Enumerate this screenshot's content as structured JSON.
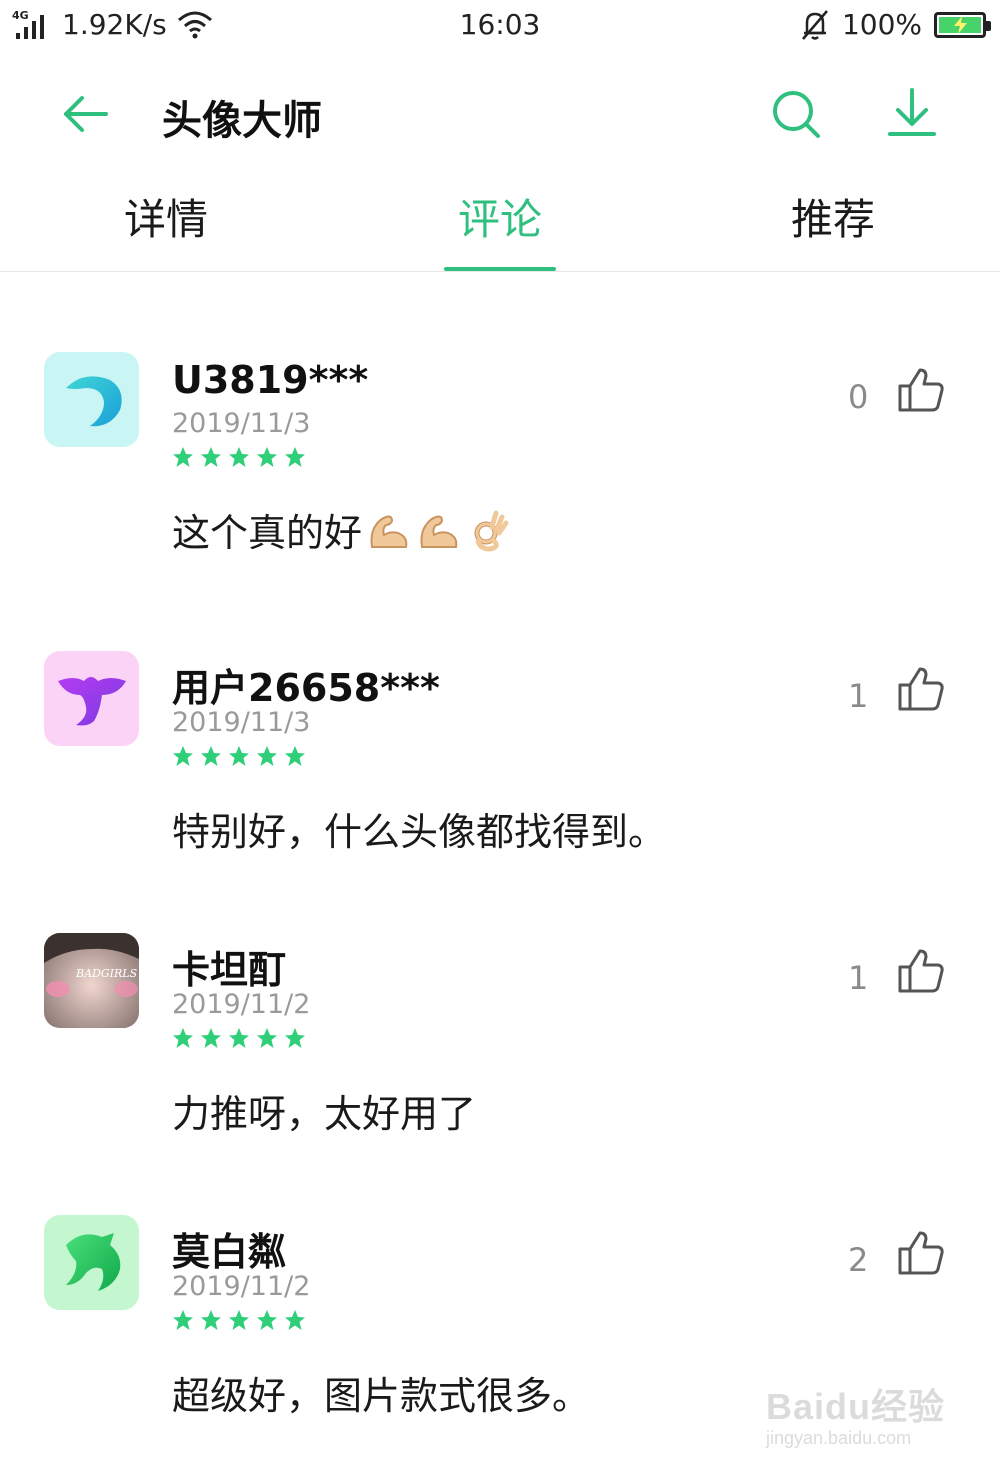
{
  "status_bar": {
    "network_tag": "4G",
    "speed": "1.92K/s",
    "time": "16:03",
    "battery_pct": "100%",
    "battery_color": "#45d36a"
  },
  "header": {
    "title": "头像大师",
    "back_icon": "arrow-left-icon",
    "search_icon": "search-icon",
    "download_icon": "download-icon",
    "accent_color": "#2fbf7f"
  },
  "tabs": [
    {
      "label": "详情",
      "active": false
    },
    {
      "label": "评论",
      "active": true
    },
    {
      "label": "推荐",
      "active": false
    }
  ],
  "reviews": [
    {
      "user": "U3819***",
      "date": "2019/11/3",
      "rating": 5,
      "text": "这个真的好",
      "emojis": [
        "flexed-biceps",
        "flexed-biceps",
        "ok-hand"
      ],
      "likes": "0",
      "avatar": "teal-wave-logo"
    },
    {
      "user": "用户26658***",
      "date": "2019/11/3",
      "rating": 5,
      "text": "特别好，什么头像都找得到。",
      "likes": "1",
      "avatar": "purple-elephant-logo"
    },
    {
      "user": "卡坦酊",
      "date": "2019/11/2",
      "rating": 5,
      "text": "力推呀，太好用了",
      "likes": "1",
      "avatar": "photo-badgirls",
      "avatar_text": "BADGIRLS"
    },
    {
      "user": "莫白粼",
      "date": "2019/11/2",
      "rating": 5,
      "text": "超级好，图片款式很多。",
      "likes": "2",
      "avatar": "green-horse-logo"
    }
  ],
  "watermark": {
    "main": "Baidu经验",
    "sub": "jingyan.baidu.com"
  }
}
